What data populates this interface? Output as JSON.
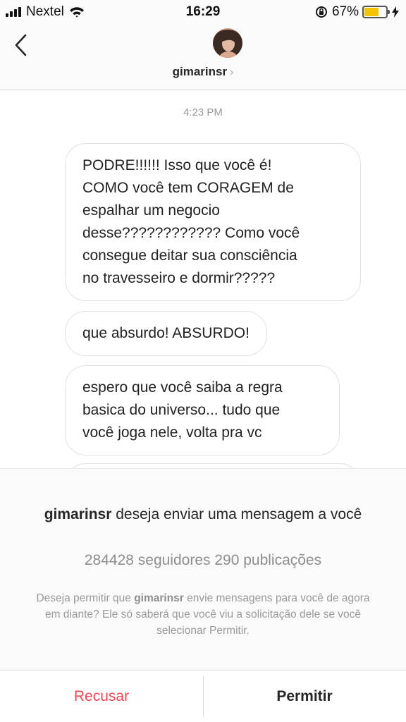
{
  "status_bar": {
    "carrier": "Nextel",
    "time": "16:29",
    "battery_percent": "67%",
    "battery_level": 0.67,
    "battery_color": "#f5c400"
  },
  "header": {
    "back_icon": "chevron-left-icon",
    "username": "gimarinsr",
    "chevron": "›"
  },
  "conversation": {
    "timestamp": "4:23 PM",
    "messages": [
      "PODRE!!!!!! Isso que você é!\nCOMO você tem CORAGEM de\nespalhar um negocio\ndesse???????????? Como você\nconsegue deitar sua consciência\nno travesseiro e dormir?????",
      "que absurdo! ABSURDO!",
      "espero que você saiba a regra\nbasica do universo... tudo que\nvocê joga nele, volta pra vc"
    ]
  },
  "request": {
    "username": "gimarinsr",
    "title_text": "deseja enviar uma mensagem a você",
    "stats": "284428 seguidores 290 publicações",
    "desc_before": "Deseja permitir que",
    "desc_username": "gimarinsr",
    "desc_after": "envie mensagens para você de agora em diante? Ele só saberá que você viu a solicitação dele se você selecionar Permitir."
  },
  "actions": {
    "decline_label": "Recusar",
    "accept_label": "Permitir",
    "decline_color": "#ed4956"
  }
}
